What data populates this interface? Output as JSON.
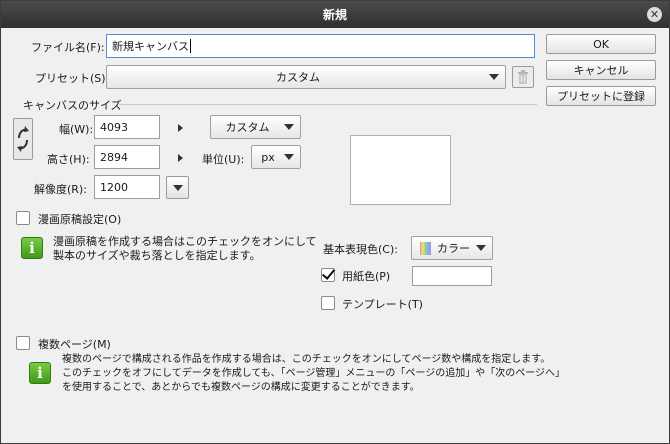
{
  "window": {
    "title": "新規"
  },
  "buttons": {
    "ok": "OK",
    "cancel": "キャンセル",
    "register_preset": "プリセットに登録"
  },
  "file_name": {
    "label": "ファイル名(F):",
    "value": "新規キャンバス"
  },
  "preset": {
    "label": "プリセット(S):",
    "value": "カスタム"
  },
  "canvas_size": {
    "section_title": "キャンバスのサイズ",
    "width_label": "幅(W):",
    "width_value": "4093",
    "height_label": "高さ(H):",
    "height_value": "2894",
    "resolution_label": "解像度(R):",
    "resolution_value": "1200",
    "size_preset_value": "カスタム",
    "unit_label": "単位(U):",
    "unit_value": "px"
  },
  "manga": {
    "checkbox_label": "漫画原稿設定(O)",
    "info_line1": "漫画原稿を作成する場合はこのチェックをオンにして",
    "info_line2": "製本のサイズや裁ち落としを指定します。"
  },
  "color": {
    "basic_color_label": "基本表現色(C):",
    "basic_color_value": "カラー",
    "paper_color_label": "用紙色(P)",
    "template_label": "テンプレート(T)"
  },
  "multi_page": {
    "checkbox_label": "複数ページ(M)",
    "info_line1": "複数のページで構成される作品を作成する場合は、このチェックをオンにしてページ数や構成を指定します。",
    "info_line2": "このチェックをオフにしてデータを作成しても、「ページ管理」メニューの「ページの追加」や「次のページへ」",
    "info_line3": "を使用することで、あとからでも複数ページの構成に変更することができます。"
  }
}
